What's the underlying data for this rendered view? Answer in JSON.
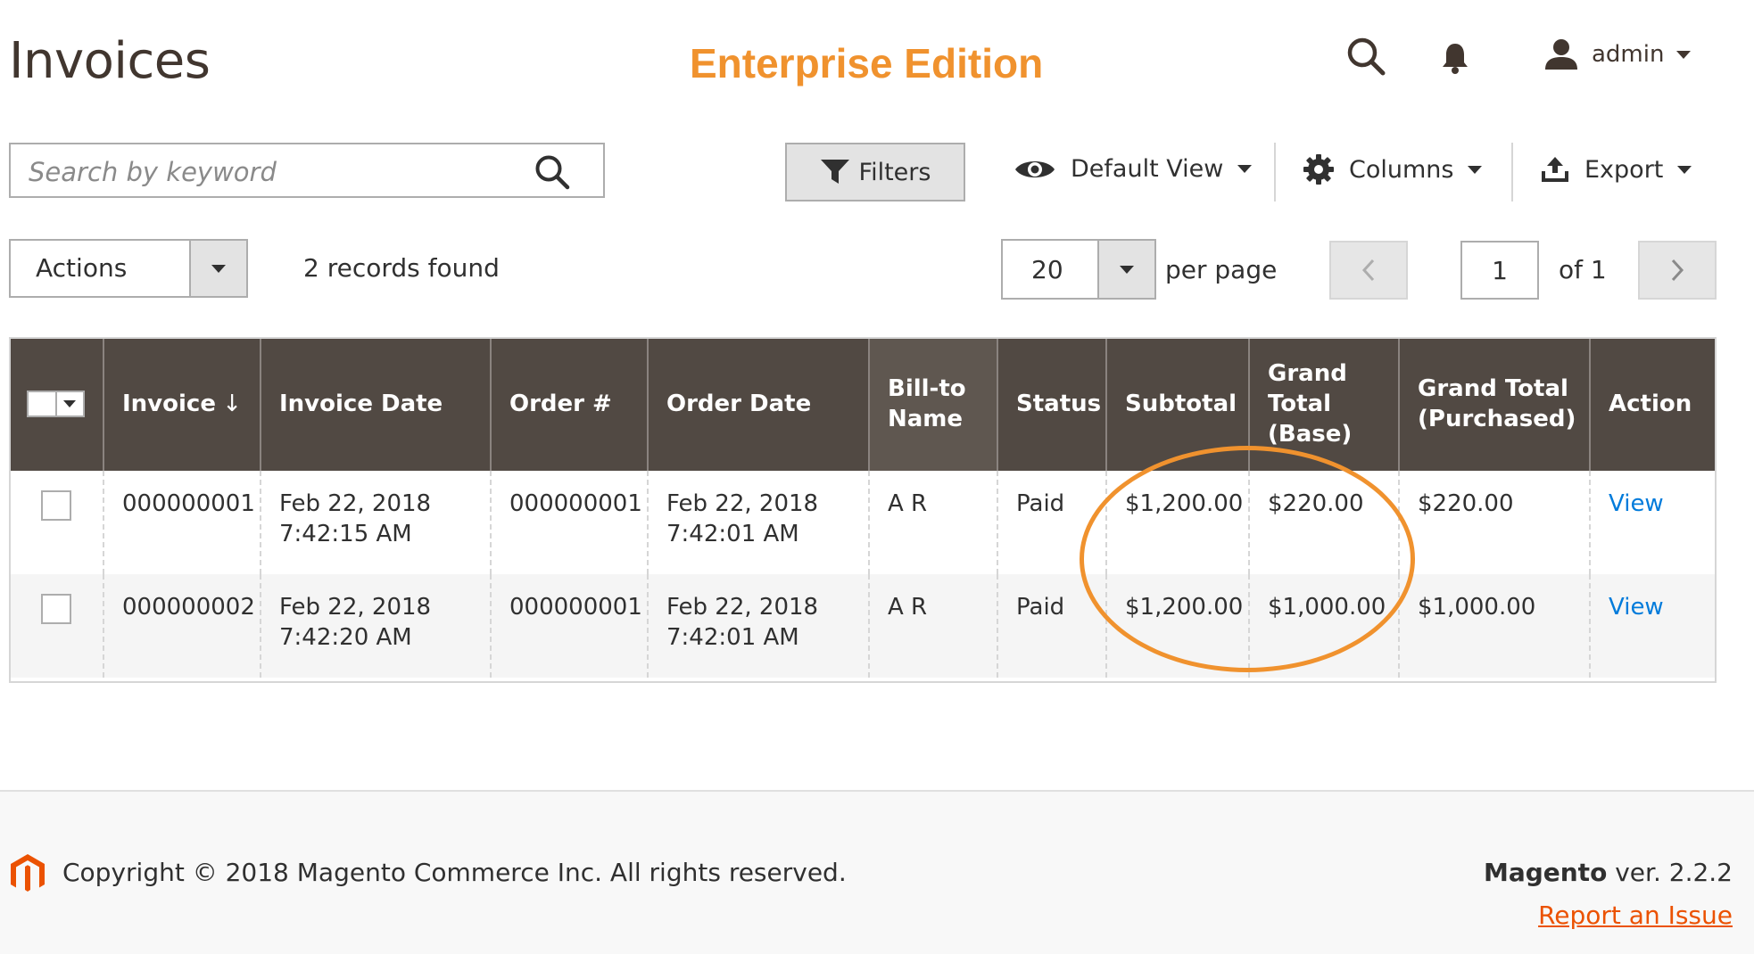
{
  "header": {
    "title": "Invoices",
    "edition": "Enterprise Edition",
    "user": "admin"
  },
  "toolbar": {
    "search_placeholder": "Search by keyword",
    "filters": "Filters",
    "default_view": "Default View",
    "columns": "Columns",
    "export": "Export",
    "actions": "Actions",
    "records_found": "2 records found",
    "per_page_value": "20",
    "per_page_label": "per page",
    "page_current": "1",
    "page_of": "of 1"
  },
  "grid": {
    "columns": [
      "Invoice",
      "Invoice Date",
      "Order #",
      "Order Date",
      "Bill-to Name",
      "Status",
      "Subtotal",
      "Grand Total (Base)",
      "Grand Total (Purchased)",
      "Action"
    ],
    "sort_indicator": "↓",
    "rows": [
      {
        "invoice": "000000001",
        "invoice_date": "Feb 22, 2018",
        "invoice_time": "7:42:15 AM",
        "order": "000000001",
        "order_date": "Feb 22, 2018",
        "order_time": "7:42:01 AM",
        "bill_to": "A R",
        "status": "Paid",
        "subtotal": "$1,200.00",
        "grand_total_base": "$220.00",
        "grand_total_purchased": "$220.00",
        "action": "View"
      },
      {
        "invoice": "000000002",
        "invoice_date": "Feb 22, 2018",
        "invoice_time": "7:42:20 AM",
        "order": "000000001",
        "order_date": "Feb 22, 2018",
        "order_time": "7:42:01 AM",
        "bill_to": "A R",
        "status": "Paid",
        "subtotal": "$1,200.00",
        "grand_total_base": "$1,000.00",
        "grand_total_purchased": "$1,000.00",
        "action": "View"
      }
    ]
  },
  "footer": {
    "copyright": "Copyright © 2018 Magento Commerce Inc. All rights reserved.",
    "brand": "Magento",
    "version": " ver. 2.2.2",
    "report": "Report an Issue"
  },
  "colors": {
    "header_bg": "#514943",
    "accent_orange": "#f0922e",
    "link_blue": "#007bdb",
    "report_orange": "#eb5202"
  }
}
